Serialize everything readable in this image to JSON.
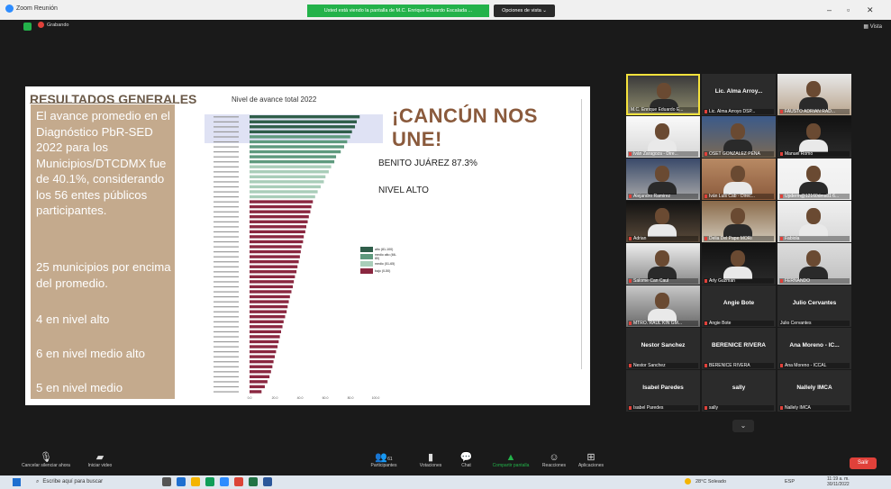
{
  "window": {
    "title": "Zoom Reunión",
    "share_banner": "Usted está viendo la pantalla de M.C. Enrique Eduardo Escalada ...",
    "view_options": "Opciones de vista ⌄",
    "minimize": "–",
    "maximize": "▫",
    "close": "✕"
  },
  "meeting": {
    "recording_label": "Grabando",
    "view_label": "▦ Vista"
  },
  "slide": {
    "title": "RESULTADOS GENERALES",
    "paragraph1": "El avance promedio en el Diagnóstico PbR-SED 2022 para los Municipios/DTCDMX fue de 40.1%, considerando los 56 entes públicos participantes.",
    "paragraph2": "25 municipios por encima del promedio.",
    "paragraph3": "4 en nivel alto",
    "paragraph4": "6 en nivel medio alto",
    "paragraph5": "5 en nivel medio",
    "headline": "¡CANCÚN NOS UNE!",
    "result": "BENITO JUÁREZ 87.3%",
    "level": "NIVEL ALTO"
  },
  "chart_data": {
    "type": "bar",
    "orientation": "horizontal",
    "title": "Nivel de avance total 2022",
    "legend": [
      {
        "label": "alto (81-100)",
        "color": "#2f5e4a"
      },
      {
        "label": "medio alto (66-80)",
        "color": "#5f9a7e"
      },
      {
        "label": "medio (51-65)",
        "color": "#a9cdb9"
      },
      {
        "label": "bajo (0-50)",
        "color": "#8a2740"
      }
    ],
    "x_ticks": [
      "0.0",
      "20.0",
      "40.0",
      "60.0",
      "80.0",
      "100.0"
    ],
    "values": [
      87.3,
      85.0,
      83.6,
      81.2,
      79.8,
      77.4,
      75.0,
      72.3,
      68.6,
      67.2,
      64.7,
      62.8,
      60.2,
      58.9,
      56.4,
      54.0,
      52.0,
      50.2,
      49.0,
      48.2,
      47.0,
      46.1,
      45.0,
      44.2,
      43.0,
      42.4,
      41.2,
      40.6,
      39.9,
      39.0,
      38.0,
      37.2,
      36.0,
      35.1,
      34.3,
      33.2,
      32.0,
      31.1,
      30.2,
      29.4,
      28.2,
      27.0,
      26.1,
      25.0,
      24.0,
      23.1,
      22.2,
      21.0,
      20.0,
      19.0,
      18.1,
      17.0,
      15.8,
      14.2,
      12.1,
      9.5
    ]
  },
  "participants": [
    {
      "name": "M.C. Enrique Eduardo E...",
      "video": true
    },
    {
      "name": "Lic. Alma Arroyo DSP...",
      "big": "Lic. Alma Arroy...",
      "video": false
    },
    {
      "name": "FAUSTO ADRIAN RAD...",
      "video": true
    },
    {
      "name": "Iván Zaragoza - Dire...",
      "video": true
    },
    {
      "name": "OSET GONZÁLEZ PEÑA",
      "video": true
    },
    {
      "name": "Manuel Romo",
      "video": true
    },
    {
      "name": "Alejandro Ramirez",
      "video": true
    },
    {
      "name": "Iván Luis Cab - Direc...",
      "video": true
    },
    {
      "name": "Upderm@12160dms81 6...",
      "video": true
    },
    {
      "name": "Adrian",
      "video": true
    },
    {
      "name": "Delia Del Pape MORI",
      "video": true
    },
    {
      "name": "Fabiola",
      "video": true
    },
    {
      "name": "Salome Can Caul",
      "video": true
    },
    {
      "name": "Arly Guzman",
      "video": true
    },
    {
      "name": "FERNANDO",
      "video": true
    },
    {
      "name": "MTRO. RAUL KIN GM...",
      "video": true
    },
    {
      "name": "Angie Bote",
      "big": "Angie Bote",
      "video": false
    },
    {
      "name": "Julio Cervantes",
      "big": "Julio Cervantes",
      "video": false
    },
    {
      "name": "Nestor Sanchez",
      "big": "Nestor Sanchez",
      "video": false
    },
    {
      "name": "BERENICE RIVERA",
      "big": "BERENICE RIVERA",
      "video": false
    },
    {
      "name": "Ana Moreno - ICCAL",
      "big": "Ana Moreno - IC...",
      "video": false
    },
    {
      "name": "Isabel Paredes",
      "big": "Isabel Paredes",
      "video": false
    },
    {
      "name": "sally",
      "big": "sally",
      "video": false
    },
    {
      "name": "Nallely IMCA",
      "big": "Nallely IMCA",
      "video": false
    }
  ],
  "toolbar": {
    "audio": "Cancelar silenciar ahora",
    "video": "Iniciar video",
    "participants": "Participantes",
    "participants_count": "61",
    "polls": "Votaciones",
    "chat": "Chat",
    "share": "Compartir pantalla",
    "reactions": "Reacciones",
    "apps": "Aplicaciones",
    "leave": "Salir",
    "more_chevron": "⌄"
  },
  "taskbar": {
    "search_placeholder": "Escribe aquí para buscar",
    "weather": "28°C Soleado",
    "lang": "ESP",
    "time": "11:19 a. m.",
    "date": "30/11/2022"
  }
}
